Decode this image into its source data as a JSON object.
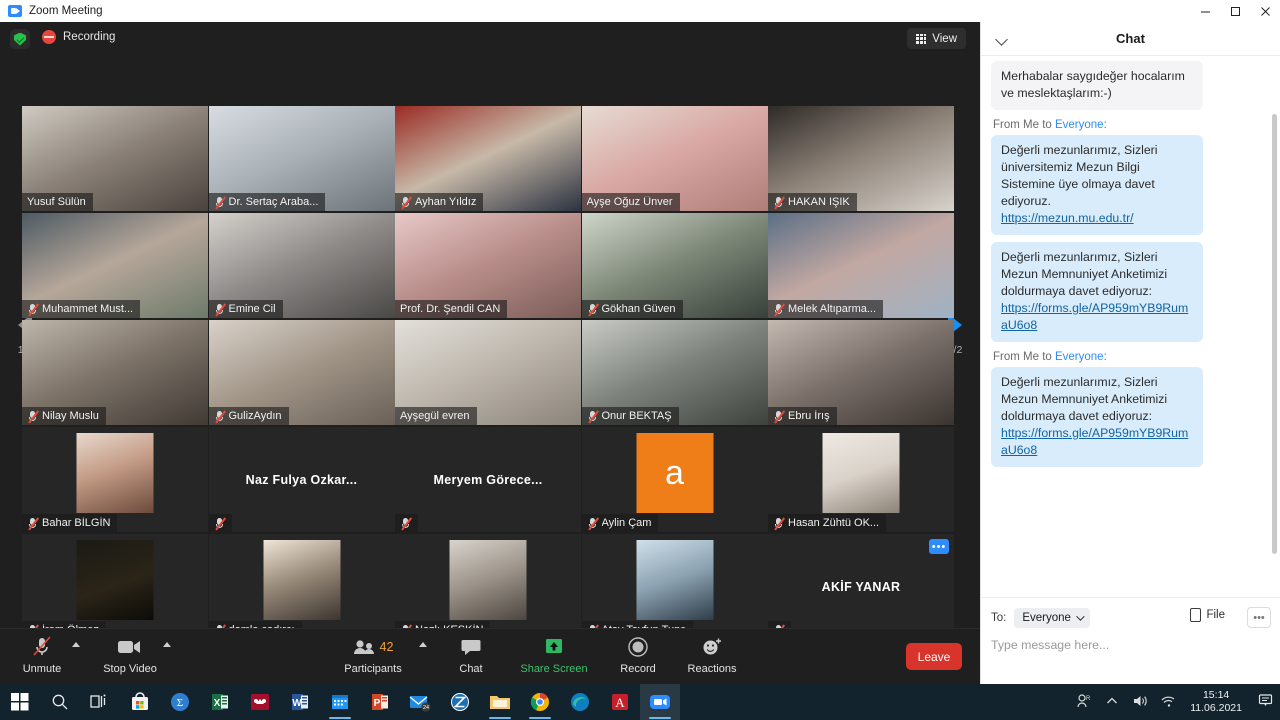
{
  "window": {
    "title": "Zoom Meeting",
    "minimize_label": "Minimize",
    "maximize_label": "Maximize",
    "close_label": "Close"
  },
  "meeting_top": {
    "encryption_label": "Encryption status",
    "recording_label": "Recording",
    "view_label": "View"
  },
  "participants_grid": {
    "page_indicator_left": "1/2",
    "page_indicator_right": "1/2",
    "rows": [
      [
        {
          "name": "Yusuf Sülün",
          "muted": false,
          "active": true,
          "kind": "video"
        },
        {
          "name": "Dr. Sertaç Araba...",
          "muted": true,
          "active": false,
          "kind": "video"
        },
        {
          "name": "Ayhan Yıldız",
          "muted": true,
          "active": false,
          "kind": "video"
        },
        {
          "name": "Ayşe Oğuz Ünver",
          "muted": false,
          "active": false,
          "kind": "video"
        },
        {
          "name": "HAKAN IŞIK",
          "muted": true,
          "active": false,
          "kind": "video"
        }
      ],
      [
        {
          "name": "Muhammet Must...",
          "muted": true,
          "active": false,
          "kind": "video"
        },
        {
          "name": "Emine Cil",
          "muted": true,
          "active": false,
          "kind": "video"
        },
        {
          "name": "Prof. Dr. Şendil CAN",
          "muted": false,
          "active": false,
          "kind": "video"
        },
        {
          "name": "Gökhan Güven",
          "muted": true,
          "active": false,
          "kind": "video"
        },
        {
          "name": "Melek Altıparma...",
          "muted": true,
          "active": false,
          "kind": "video"
        }
      ],
      [
        {
          "name": "Nilay Muslu",
          "muted": true,
          "active": false,
          "kind": "video"
        },
        {
          "name": "GulizAydın",
          "muted": true,
          "active": false,
          "kind": "video"
        },
        {
          "name": "Ayşegül evren",
          "muted": false,
          "active": false,
          "kind": "video"
        },
        {
          "name": "Onur BEKTAŞ",
          "muted": true,
          "active": false,
          "kind": "video"
        },
        {
          "name": "Ebru İrış",
          "muted": true,
          "active": false,
          "kind": "video"
        }
      ],
      [
        {
          "name": "Bahar BİLGİN",
          "muted": true,
          "active": false,
          "kind": "photo"
        },
        {
          "name": "",
          "muted": true,
          "active": false,
          "kind": "name",
          "center_name": "Naz  Fulya  Ozkar..."
        },
        {
          "name": "",
          "muted": true,
          "active": false,
          "kind": "name",
          "center_name": "Meryem  Görece..."
        },
        {
          "name": "Aylin Çam",
          "muted": true,
          "active": false,
          "kind": "letter",
          "letter": "a"
        },
        {
          "name": "Hasan Zühtü OK...",
          "muted": true,
          "active": false,
          "kind": "photo"
        }
      ],
      [
        {
          "name": "İrem Ölmez",
          "muted": true,
          "active": false,
          "kind": "photo"
        },
        {
          "name": "damla çadırcı",
          "muted": true,
          "active": false,
          "kind": "photo"
        },
        {
          "name": "Nazlı KESKİN",
          "muted": true,
          "active": false,
          "kind": "photo"
        },
        {
          "name": "Atay Tayfun Tunç",
          "muted": true,
          "active": false,
          "kind": "photo"
        },
        {
          "name": "",
          "muted": true,
          "active": false,
          "kind": "name",
          "center_name": "AKİF YANAR",
          "has_more": true,
          "more_label": "•••"
        }
      ]
    ]
  },
  "toolbar": {
    "mute_label": "Unmute",
    "video_label": "Stop Video",
    "participants_label": "Participants",
    "participants_count": "42",
    "chat_label": "Chat",
    "share_label": "Share Screen",
    "record_label": "Record",
    "reactions_label": "Reactions",
    "leave_label": "Leave"
  },
  "chat": {
    "title": "Chat",
    "messages": [
      {
        "header": null,
        "style": "grey",
        "text": "Merhabalar saygıdeğer hocalarım ve meslektaşlarım:-)",
        "link": null
      },
      {
        "header_from": "From Me to ",
        "header_who": "Everyone",
        "header_colon": ":",
        "style": "blue",
        "text": "Değerli mezunlarımız, Sizleri üniversitemiz Mezun Bilgi Sistemine üye olmaya davet ediyoruz.",
        "link": "https://mezun.mu.edu.tr/"
      },
      {
        "header": null,
        "style": "blue",
        "text": "Değerli mezunlarımız, Sizleri Mezun Memnuniyet Anketimizi doldurmaya davet ediyoruz:",
        "link": "https://forms.gle/AP959mYB9RumaU6o8"
      },
      {
        "header_from": "From Me to ",
        "header_who": "Everyone",
        "header_colon": ":",
        "style": "blue",
        "text": "Değerli mezunlarımız, Sizleri Mezun Memnuniyet Anketimizi doldurmaya davet ediyoruz:",
        "link": "https://forms.gle/AP959mYB9RumaU6o8"
      }
    ],
    "footer": {
      "to_label": "To:",
      "to_value": "Everyone",
      "file_label": "File",
      "more_label": "•••",
      "input_placeholder": "Type message here..."
    }
  },
  "taskbar": {
    "apps": [
      {
        "name": "start-button",
        "glyph": "start"
      },
      {
        "name": "search-button",
        "glyph": "search"
      },
      {
        "name": "task-view-button",
        "glyph": "taskview"
      },
      {
        "name": "microsoft-store",
        "glyph": "store"
      },
      {
        "name": "mendeley-app",
        "glyph": "sigma"
      },
      {
        "name": "excel-app",
        "glyph": "excel"
      },
      {
        "name": "mendeley-desktop",
        "glyph": "mendeley"
      },
      {
        "name": "word-app",
        "glyph": "word"
      },
      {
        "name": "calendar-app",
        "glyph": "calendar"
      },
      {
        "name": "powerpoint-app",
        "glyph": "ppt"
      },
      {
        "name": "mail-app",
        "glyph": "mail",
        "badge": "24"
      },
      {
        "name": "zotero-app",
        "glyph": "zotero"
      },
      {
        "name": "file-explorer",
        "glyph": "folder"
      },
      {
        "name": "chrome-browser",
        "glyph": "chrome"
      },
      {
        "name": "edge-browser",
        "glyph": "edge"
      },
      {
        "name": "acrobat-reader",
        "glyph": "pdf"
      },
      {
        "name": "zoom-app",
        "glyph": "zoom",
        "active": true
      }
    ],
    "tray": {
      "people_label": "People",
      "chevron_label": "Show hidden icons",
      "volume_label": "Volume",
      "network_label": "Network",
      "time": "15:14",
      "date": "11.06.2021",
      "notifications_label": "Notifications"
    }
  }
}
